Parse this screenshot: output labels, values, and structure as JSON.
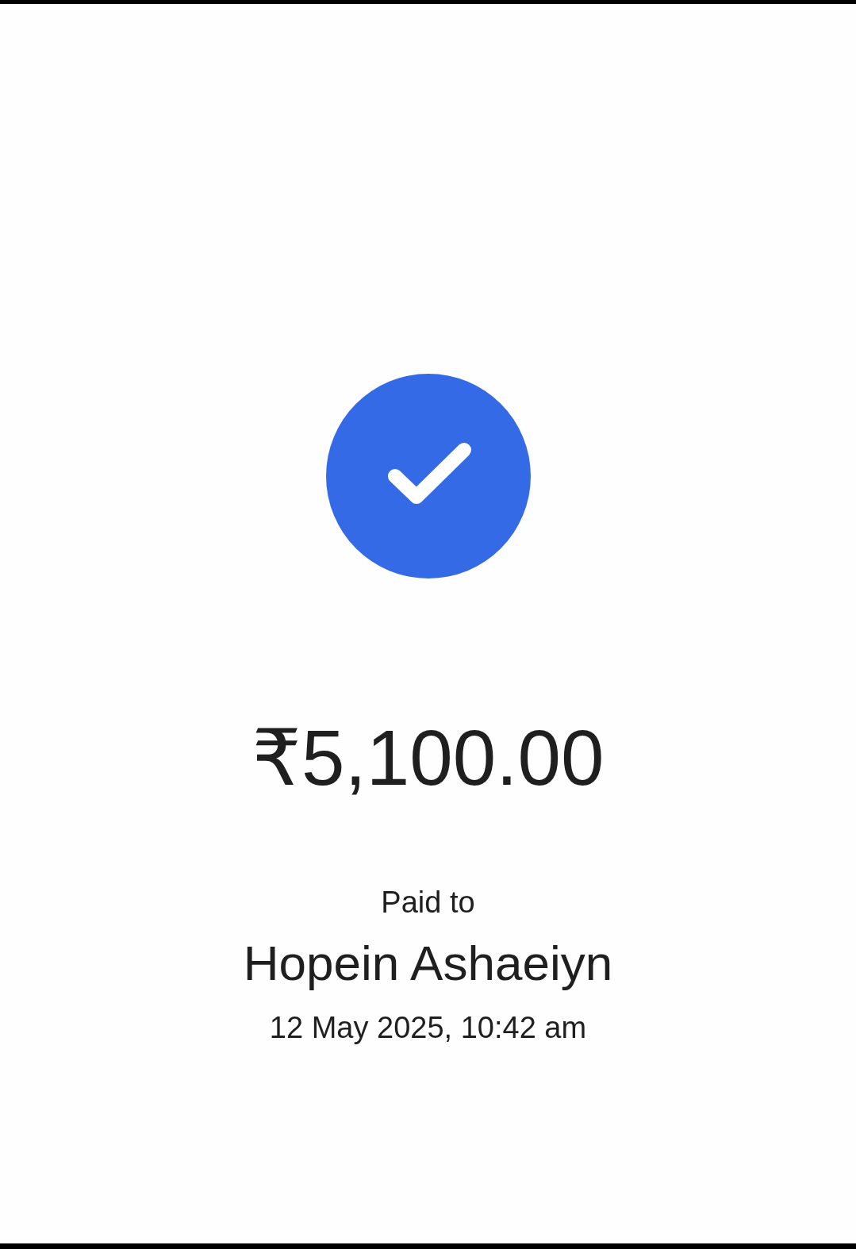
{
  "amount": "₹5,100.00",
  "paid_label": "Paid to",
  "payee": "Hopein Ashaeiyn",
  "timestamp": "12 May 2025, 10:42 am"
}
